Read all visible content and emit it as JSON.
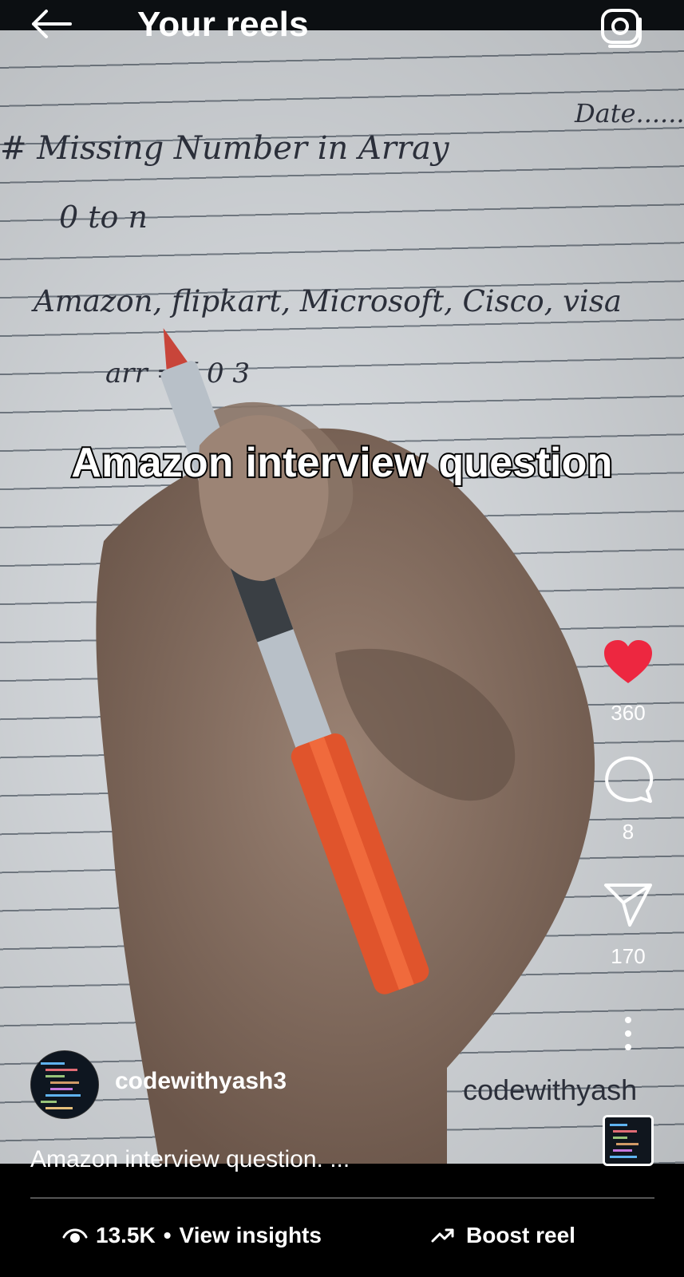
{
  "header": {
    "title": "Your reels",
    "back_icon": "arrow-left-icon",
    "camera_icon": "camera-icon"
  },
  "video": {
    "handwriting": {
      "date": "Date........",
      "title": "# Missing Number in Array",
      "range": "0 to n",
      "companies": "Amazon, flipkart, Microsoft, Cisco, visa",
      "arr": "arr = [ 0 3"
    },
    "overlay_text": "Amazon interview question",
    "watermark": "codewithyash"
  },
  "actions": {
    "likes": "360",
    "comments": "8",
    "shares": "170",
    "like_color": "#ed2740"
  },
  "profile": {
    "username": "codewithyash3"
  },
  "caption": "Amazon interview question. ...",
  "footer": {
    "views": "13.5K",
    "separator": "•",
    "insights_label": "View insights",
    "boost_label": "Boost reel"
  }
}
